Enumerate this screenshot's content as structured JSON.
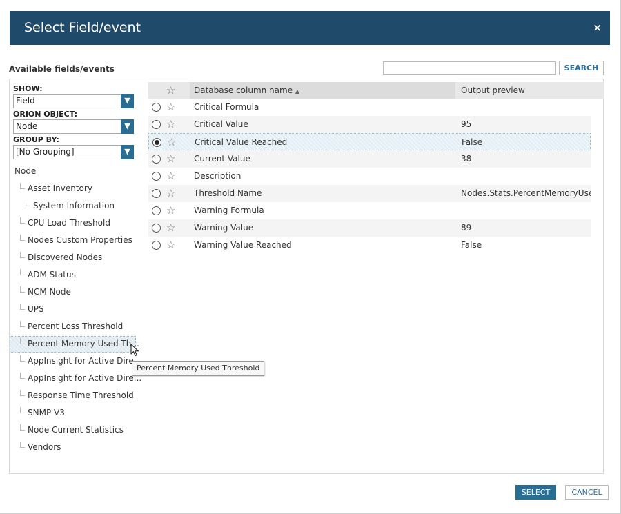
{
  "dialog": {
    "title": "Select Field/event",
    "close_label": "×"
  },
  "available": {
    "label": "Available fields/events",
    "search_placeholder": "",
    "search_value": "",
    "search_button": "SEARCH"
  },
  "filters": {
    "show": {
      "label": "SHOW:",
      "value": "Field"
    },
    "orion_object": {
      "label": "ORION OBJECT:",
      "value": "Node"
    },
    "group_by": {
      "label": "GROUP BY:",
      "value": "[No Grouping]"
    },
    "arrow": "▼"
  },
  "tree": {
    "root": "Node",
    "items": [
      "Asset Inventory",
      "System Information",
      "CPU Load Threshold",
      "Nodes Custom Properties",
      "Discovered Nodes",
      "ADM Status",
      "NCM Node",
      "UPS",
      "Percent Loss Threshold",
      "Percent Memory Used Th...",
      "AppInsight for Active Dire...",
      "AppInsight for Active Dire...",
      "Response Time Threshold",
      "SNMP V3",
      "Node Current Statistics",
      "Vendors"
    ]
  },
  "tooltip": "Percent Memory Used Threshold",
  "grid": {
    "star_header": "☆",
    "col_name": "Database column name",
    "sort_indicator": "▲",
    "col_preview": "Output preview",
    "rows": [
      {
        "name": "Critical Formula",
        "preview": ""
      },
      {
        "name": "Critical Value",
        "preview": "95"
      },
      {
        "name": "Critical Value Reached",
        "preview": "False"
      },
      {
        "name": "Current Value",
        "preview": "38"
      },
      {
        "name": "Description",
        "preview": ""
      },
      {
        "name": "Threshold Name",
        "preview": "Nodes.Stats.PercentMemoryUsed"
      },
      {
        "name": "Warning Formula",
        "preview": ""
      },
      {
        "name": "Warning Value",
        "preview": "89"
      },
      {
        "name": "Warning Value Reached",
        "preview": "False"
      }
    ],
    "selected_row": 2
  },
  "footer": {
    "select": "SELECT",
    "cancel": "CANCEL"
  },
  "colors": {
    "titlebar": "#1f4a6a",
    "accent": "#2a6d93",
    "link": "#2c6e9e"
  }
}
